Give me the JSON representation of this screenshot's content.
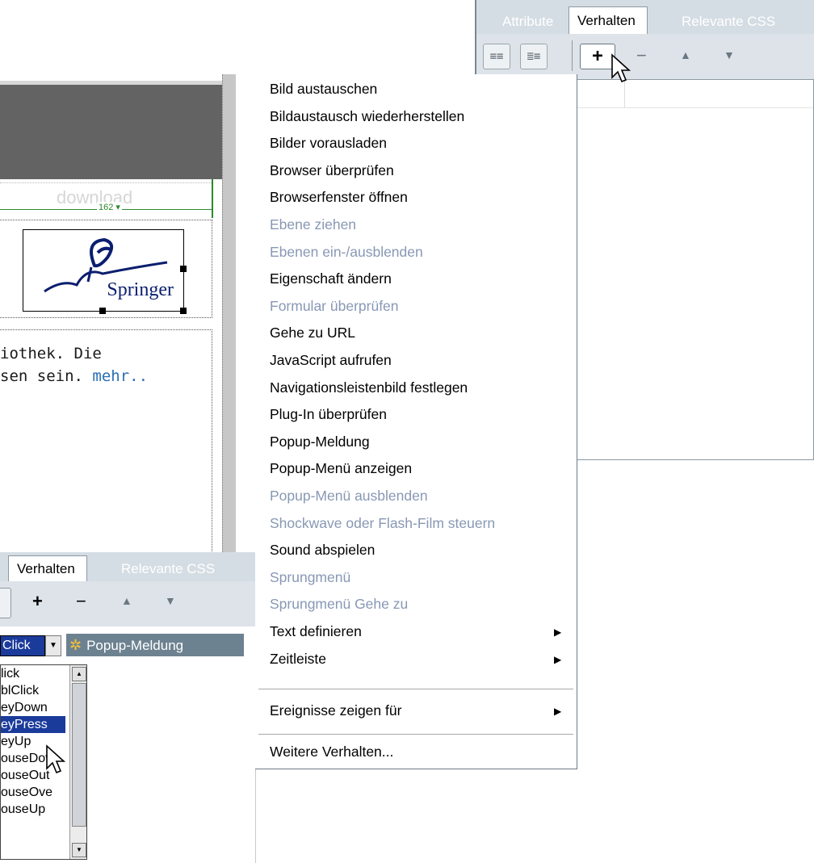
{
  "top_panel": {
    "tabs": [
      "Attribute",
      "Verhalten",
      "Relevante CSS"
    ],
    "toolbar": {
      "show_set_events": "≡≡",
      "show_all_events": "≣≡",
      "add": "+",
      "remove": "−",
      "up": "▲",
      "down": "▼"
    }
  },
  "document": {
    "download_ghost": "download",
    "width_label": "162 ▾",
    "logo_text": "Springer",
    "text_line1": "iothek. Die",
    "text_line2_prefix": "sen sein. ",
    "text_line2_link": "mehr.."
  },
  "bottom_panel": {
    "tabs": [
      "Verhalten",
      "Relevante CSS"
    ],
    "toolbar": {
      "add": "+",
      "remove": "−",
      "up": "▲",
      "down": "▼"
    },
    "event_selected": "Click",
    "action_label": "Popup-Meldung",
    "events": [
      "lick",
      "blClick",
      "eyDown",
      "eyPress",
      "eyUp",
      "ouseDov",
      "ouseOut",
      "ouseOve",
      "ouseUp"
    ],
    "selected_event_index": 3
  },
  "menu": {
    "items": [
      {
        "label": "Bild austauschen",
        "enabled": true
      },
      {
        "label": "Bildaustausch wiederherstellen",
        "enabled": true
      },
      {
        "label": "Bilder vorausladen",
        "enabled": true
      },
      {
        "label": "Browser überprüfen",
        "enabled": true
      },
      {
        "label": "Browserfenster öffnen",
        "enabled": true
      },
      {
        "label": "Ebene ziehen",
        "enabled": false
      },
      {
        "label": "Ebenen ein-/ausblenden",
        "enabled": false
      },
      {
        "label": "Eigenschaft ändern",
        "enabled": true
      },
      {
        "label": "Formular überprüfen",
        "enabled": false
      },
      {
        "label": "Gehe zu URL",
        "enabled": true
      },
      {
        "label": "JavaScript aufrufen",
        "enabled": true
      },
      {
        "label": "Navigationsleistenbild festlegen",
        "enabled": true
      },
      {
        "label": "Plug-In überprüfen",
        "enabled": true
      },
      {
        "label": "Popup-Meldung",
        "enabled": true
      },
      {
        "label": "Popup-Menü anzeigen",
        "enabled": true
      },
      {
        "label": "Popup-Menü ausblenden",
        "enabled": false
      },
      {
        "label": "Shockwave oder Flash-Film steuern",
        "enabled": false
      },
      {
        "label": "Sound abspielen",
        "enabled": true
      },
      {
        "label": "Sprungmenü",
        "enabled": false
      },
      {
        "label": "Sprungmenü Gehe zu",
        "enabled": false
      },
      {
        "label": "Text definieren",
        "enabled": true,
        "submenu": true
      },
      {
        "label": "Zeitleiste",
        "enabled": true,
        "submenu": true
      }
    ],
    "events_for": {
      "label": "Ereignisse zeigen für",
      "submenu": true
    },
    "more": {
      "label": "Weitere Verhalten..."
    },
    "disabled_color": "#8898b4"
  }
}
